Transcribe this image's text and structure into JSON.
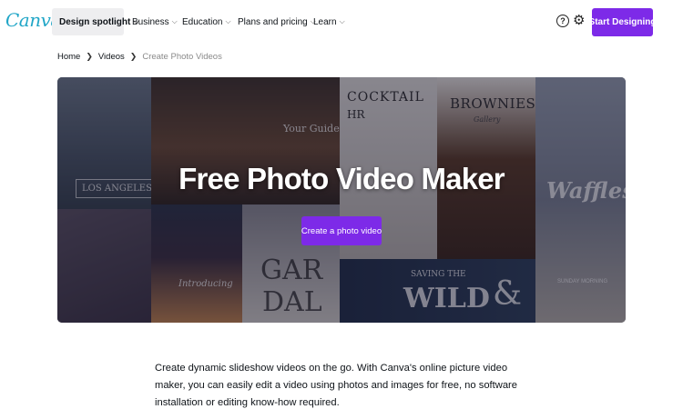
{
  "logo": "Canva",
  "nav": {
    "items": [
      {
        "label": "Design spotlight",
        "active": true
      },
      {
        "label": "Business",
        "active": false
      },
      {
        "label": "Education",
        "active": false
      },
      {
        "label": "Plans and pricing",
        "active": false
      },
      {
        "label": "Learn",
        "active": false
      }
    ],
    "help_icon": "?",
    "cta_label": "Start Designing"
  },
  "breadcrumb": {
    "home": "Home",
    "videos": "Videos",
    "current": "Create Photo Videos"
  },
  "hero": {
    "title": "Free Photo Video Maker",
    "button_label": "Create a photo video",
    "collage": {
      "cocktail": "COCKTAIL",
      "hr": "HR",
      "brownies": "BROWNIES",
      "brownies_sub": "Gallery",
      "los_angeles": "LOS ANGELES",
      "your_guide": "Your Guide",
      "waffles": "Waffles",
      "introducing": "Introducing",
      "garda": "GAR",
      "garda2": "DAL",
      "saving_the": "SAVING THE",
      "wild": "WILD",
      "amp": "&",
      "sunday": "SUNDAY MORNING"
    }
  },
  "description": "Create dynamic slideshow videos on the go. With Canva's online picture video maker, you can easily edit a video using photos and images for free, no software installation or editing know-how required.",
  "colors": {
    "brand_purple": "#7d2ae8",
    "logo_teal": "#21a6c7"
  }
}
